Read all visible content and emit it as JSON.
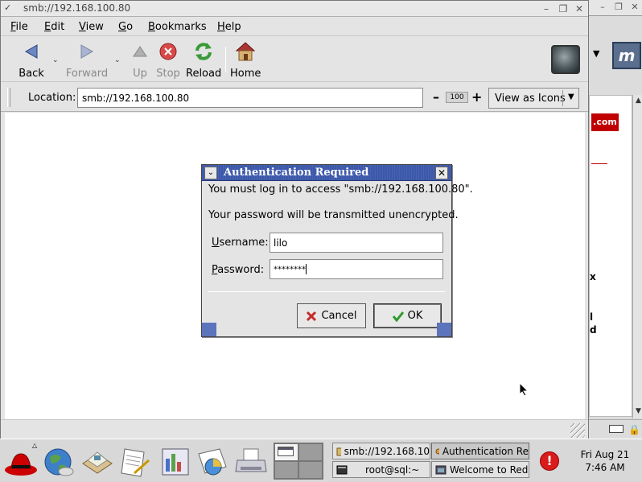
{
  "window": {
    "title": "smb://192.168.100.80",
    "controls": [
      "minimize",
      "maximize",
      "close"
    ]
  },
  "menubar": [
    {
      "label": "File",
      "mnemonic": "F"
    },
    {
      "label": "Edit",
      "mnemonic": "E"
    },
    {
      "label": "View",
      "mnemonic": "V"
    },
    {
      "label": "Go",
      "mnemonic": "G"
    },
    {
      "label": "Bookmarks",
      "mnemonic": "B"
    },
    {
      "label": "Help",
      "mnemonic": "H"
    }
  ],
  "toolbar": {
    "back": "Back",
    "forward": "Forward",
    "up": "Up",
    "stop": "Stop",
    "reload": "Reload",
    "home": "Home"
  },
  "location": {
    "label": "Location:",
    "value": "smb://192.168.100.80",
    "zoom": "100",
    "view_as": "View as Icons"
  },
  "dialog": {
    "title": "Authentication Required",
    "message": "You must log in to access \"smb://192.168.100.80\".",
    "warning": "Your password will be transmitted unencrypted.",
    "username_label": "Username:",
    "username_value": "lilo",
    "password_label": "Password:",
    "password_value": "********",
    "cancel": "Cancel",
    "ok": "OK"
  },
  "background_window": {
    "badge": ".com",
    "fragment_x": "x",
    "fragment_l": "l",
    "fragment_d": "d"
  },
  "panel": {
    "tasks": [
      {
        "label": "smb://192.168.10",
        "icon": "folder-icon",
        "active": false
      },
      {
        "label": "Authentication Re",
        "icon": "key-icon",
        "active": true
      },
      {
        "label": "root@sql:~",
        "icon": "terminal-icon",
        "active": false
      },
      {
        "label": "Welcome to Red",
        "icon": "browser-icon",
        "active": false
      }
    ],
    "clock_date": "Fri Aug 21",
    "clock_time": "7:46 AM"
  },
  "colors": {
    "dialog_title": "#3c58a8",
    "alert": "#d81b1b",
    "redhat": "#cc0000"
  }
}
